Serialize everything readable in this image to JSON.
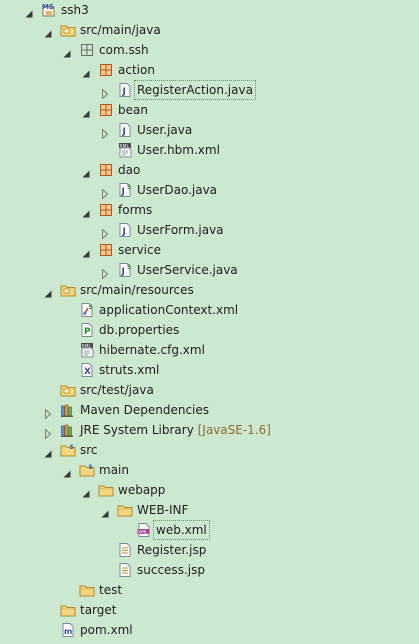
{
  "project_tree": [
    {
      "label": "ssh3",
      "suffix": "",
      "depth": 0,
      "toggle": "open",
      "icon": "maven-project-icon"
    },
    {
      "label": "src/main/java",
      "suffix": "",
      "depth": 1,
      "toggle": "open",
      "icon": "source-folder-icon"
    },
    {
      "label": "com.ssh",
      "suffix": "",
      "depth": 2,
      "toggle": "open",
      "icon": "empty-package-icon"
    },
    {
      "label": "action",
      "suffix": "",
      "depth": 3,
      "toggle": "open",
      "icon": "package-icon"
    },
    {
      "label": "RegisterAction.java",
      "suffix": "",
      "depth": 4,
      "toggle": "closed",
      "icon": "java-file-icon",
      "selected": true
    },
    {
      "label": "bean",
      "suffix": "",
      "depth": 3,
      "toggle": "open",
      "icon": "package-icon"
    },
    {
      "label": "User.java",
      "suffix": "",
      "depth": 4,
      "toggle": "closed",
      "icon": "java-file-icon"
    },
    {
      "label": "User.hbm.xml",
      "suffix": "",
      "depth": 4,
      "toggle": "none",
      "icon": "hibernate-mapping-icon"
    },
    {
      "label": "dao",
      "suffix": "",
      "depth": 3,
      "toggle": "open",
      "icon": "package-icon"
    },
    {
      "label": "UserDao.java",
      "suffix": "",
      "depth": 4,
      "toggle": "closed",
      "icon": "spring-java-file-icon"
    },
    {
      "label": "forms",
      "suffix": "",
      "depth": 3,
      "toggle": "open",
      "icon": "package-icon"
    },
    {
      "label": "UserForm.java",
      "suffix": "",
      "depth": 4,
      "toggle": "closed",
      "icon": "java-file-icon"
    },
    {
      "label": "service",
      "suffix": "",
      "depth": 3,
      "toggle": "open",
      "icon": "package-icon"
    },
    {
      "label": "UserService.java",
      "suffix": "",
      "depth": 4,
      "toggle": "closed",
      "icon": "spring-java-file-icon"
    },
    {
      "label": "src/main/resources",
      "suffix": "",
      "depth": 1,
      "toggle": "open",
      "icon": "source-folder-icon"
    },
    {
      "label": "applicationContext.xml",
      "suffix": "",
      "depth": 2,
      "toggle": "none",
      "icon": "spring-config-icon"
    },
    {
      "label": "db.properties",
      "suffix": "",
      "depth": 2,
      "toggle": "none",
      "icon": "properties-file-icon"
    },
    {
      "label": "hibernate.cfg.xml",
      "suffix": "",
      "depth": 2,
      "toggle": "none",
      "icon": "hibernate-config-icon"
    },
    {
      "label": "struts.xml",
      "suffix": "",
      "depth": 2,
      "toggle": "none",
      "icon": "xml-file-icon"
    },
    {
      "label": "src/test/java",
      "suffix": "",
      "depth": 1,
      "toggle": "none",
      "icon": "source-folder-icon"
    },
    {
      "label": "Maven Dependencies",
      "suffix": "",
      "depth": 1,
      "toggle": "closed",
      "icon": "library-icon"
    },
    {
      "label": "JRE System Library",
      "suffix": "[JavaSE-1.6]",
      "depth": 1,
      "toggle": "closed",
      "icon": "library-icon"
    },
    {
      "label": "src",
      "suffix": "",
      "depth": 1,
      "toggle": "open",
      "icon": "spring-folder-icon"
    },
    {
      "label": "main",
      "suffix": "",
      "depth": 2,
      "toggle": "open",
      "icon": "spring-folder-icon"
    },
    {
      "label": "webapp",
      "suffix": "",
      "depth": 3,
      "toggle": "open",
      "icon": "folder-icon"
    },
    {
      "label": "WEB-INF",
      "suffix": "",
      "depth": 4,
      "toggle": "open",
      "icon": "folder-icon"
    },
    {
      "label": "web.xml",
      "suffix": "",
      "depth": 5,
      "toggle": "none",
      "icon": "web-xml-icon",
      "selected": true
    },
    {
      "label": "Register.jsp",
      "suffix": "",
      "depth": 4,
      "toggle": "none",
      "icon": "jsp-file-icon"
    },
    {
      "label": "success.jsp",
      "suffix": "",
      "depth": 4,
      "toggle": "none",
      "icon": "jsp-file-icon"
    },
    {
      "label": "test",
      "suffix": "",
      "depth": 2,
      "toggle": "none",
      "icon": "folder-icon"
    },
    {
      "label": "target",
      "suffix": "",
      "depth": 1,
      "toggle": "none",
      "icon": "folder-icon"
    },
    {
      "label": "pom.xml",
      "suffix": "",
      "depth": 1,
      "toggle": "none",
      "icon": "maven-pom-icon"
    }
  ]
}
